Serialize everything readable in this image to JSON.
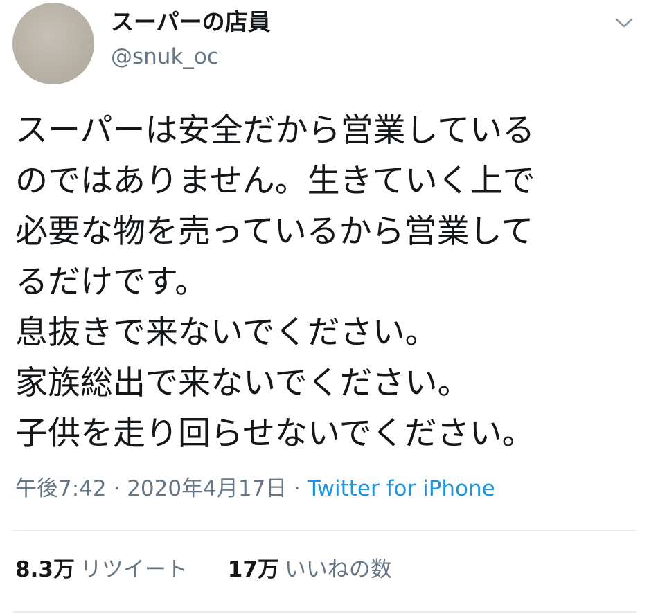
{
  "author": {
    "display_name": "スーパーの店員",
    "handle": "@snuk_oc",
    "avatar_color": "#b8b1a6"
  },
  "menu_icon": "chevron-down-icon",
  "tweet": {
    "lines": [
      "スーパーは安全だから営業している",
      "のではありません。生きていく上で",
      "必要な物を売っているから営業して",
      "るだけです。",
      "息抜きで来ないでください。",
      "家族総出で来ないでください。",
      "子供を走り回らせないでください。"
    ]
  },
  "meta": {
    "time": "午後7:42",
    "separator": "·",
    "date": "2020年4月17日",
    "source": "Twitter for iPhone",
    "source_color": "#1b95e0"
  },
  "stats": {
    "retweets_count": "8.3万",
    "retweets_label": "リツイート",
    "likes_count": "17万",
    "likes_label": "いいねの数"
  }
}
